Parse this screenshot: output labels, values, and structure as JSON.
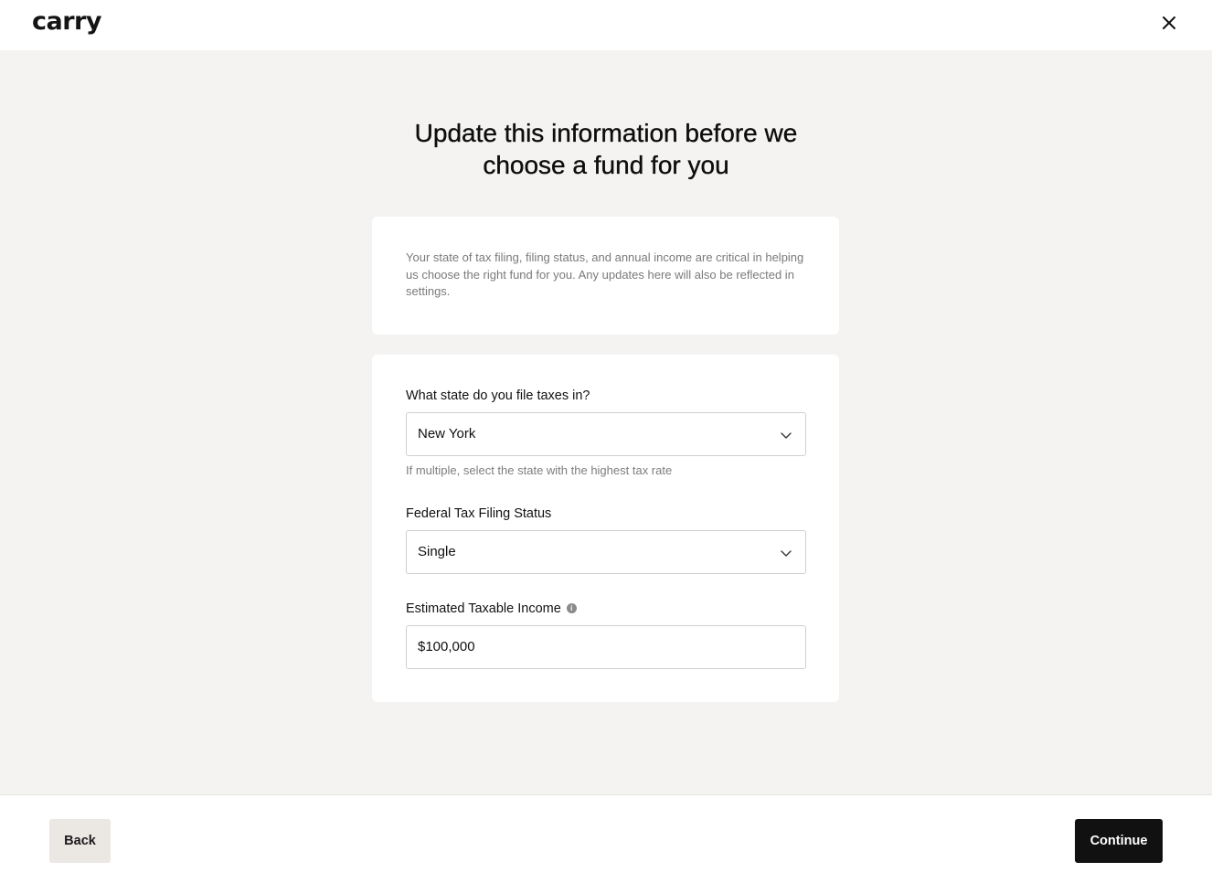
{
  "header": {
    "logo": "carry",
    "close_icon": "close-icon"
  },
  "main": {
    "title": "Update this information before we choose a fund for you",
    "info_text": "Your state of tax filing, filing status, and annual income are critical in helping us choose the right fund for you. Any updates here will also be reflected in settings."
  },
  "form": {
    "state": {
      "label": "What state do you file taxes in?",
      "value": "New York",
      "hint": "If multiple, select the state with the highest tax rate",
      "icon": "chevron-down-icon"
    },
    "filing_status": {
      "label": "Federal Tax Filing Status",
      "value": "Single",
      "icon": "chevron-down-icon"
    },
    "income": {
      "label": "Estimated Taxable Income",
      "value": "$100,000",
      "info_icon": "info-icon"
    }
  },
  "footer": {
    "back_label": "Back",
    "continue_label": "Continue"
  },
  "colors": {
    "background": "#f4f3f1",
    "card": "#ffffff",
    "primary_button": "#111111",
    "secondary_button": "#ebe8e4",
    "muted_text": "#7a7a7a"
  }
}
